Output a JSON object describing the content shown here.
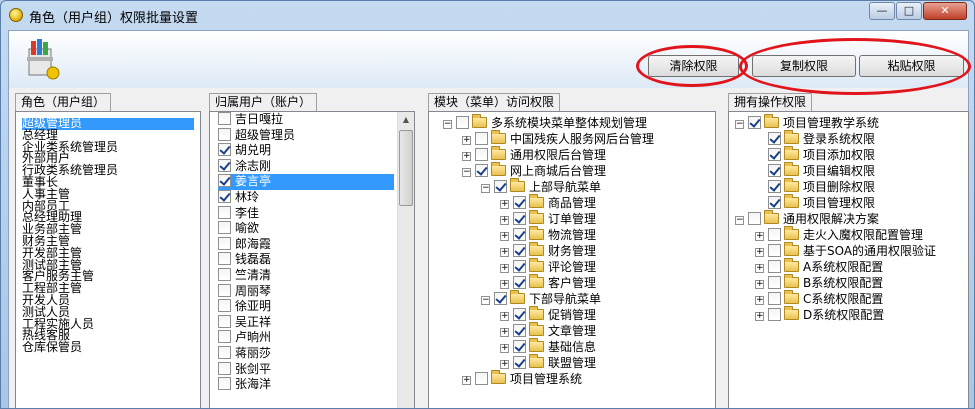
{
  "window": {
    "title": "角色（用户组）权限批量设置",
    "min_label": "—",
    "max_label": "□",
    "close_label": "✕"
  },
  "toolbar": {
    "clear_label": "清除权限",
    "copy_label": "复制权限",
    "paste_label": "粘贴权限"
  },
  "roles": {
    "header": "角色（用户组）",
    "items": [
      "超级管理员",
      "总经理",
      "企业类系统管理员",
      "外部用户",
      "行政类系统管理员",
      "董事长",
      "人事主管",
      "内部员工",
      "总经理助理",
      "业务部主管",
      "财务主管",
      "开发部主管",
      "测试部主管",
      "客户服务主管",
      "工程部主管",
      "开发人员",
      "测试人员",
      "工程实施人员",
      "热线客服",
      "仓库保管员"
    ],
    "selected_index": 0
  },
  "users": {
    "header": "归属用户（账户）",
    "items": [
      {
        "name": "吉日嘎拉",
        "checked": false
      },
      {
        "name": "超级管理员",
        "checked": false
      },
      {
        "name": "胡兑明",
        "checked": true
      },
      {
        "name": "涂志刚",
        "checked": true
      },
      {
        "name": "姜言亭",
        "checked": true
      },
      {
        "name": "林玲",
        "checked": true
      },
      {
        "name": "李佳",
        "checked": false
      },
      {
        "name": "喻欲",
        "checked": false
      },
      {
        "name": "郎海霞",
        "checked": false
      },
      {
        "name": "钱磊磊",
        "checked": false
      },
      {
        "name": "竺清清",
        "checked": false
      },
      {
        "name": "周丽琴",
        "checked": false
      },
      {
        "name": "徐亚明",
        "checked": false
      },
      {
        "name": "吴正祥",
        "checked": false
      },
      {
        "name": "卢晌州",
        "checked": false
      },
      {
        "name": "蒋丽莎",
        "checked": false
      },
      {
        "name": "张剑平",
        "checked": false
      },
      {
        "name": "张海洋",
        "checked": false
      }
    ],
    "selected_index": 4
  },
  "modules": {
    "header": "模块（菜单）访问权限",
    "nodes": [
      {
        "label": "多系统模块菜单整体规划管理",
        "level": 0,
        "exp": "-",
        "checked": false
      },
      {
        "label": "中国残疾人服务网后台管理",
        "level": 1,
        "exp": "+",
        "checked": false
      },
      {
        "label": "通用权限后台管理",
        "level": 1,
        "exp": "+",
        "checked": false
      },
      {
        "label": "网上商城后台管理",
        "level": 1,
        "exp": "-",
        "checked": true
      },
      {
        "label": "上部导航菜单",
        "level": 2,
        "exp": "-",
        "checked": true
      },
      {
        "label": "商品管理",
        "level": 3,
        "exp": "+",
        "checked": true
      },
      {
        "label": "订单管理",
        "level": 3,
        "exp": "+",
        "checked": true
      },
      {
        "label": "物流管理",
        "level": 3,
        "exp": "+",
        "checked": true
      },
      {
        "label": "财务管理",
        "level": 3,
        "exp": "+",
        "checked": true
      },
      {
        "label": "评论管理",
        "level": 3,
        "exp": "+",
        "checked": true
      },
      {
        "label": "客户管理",
        "level": 3,
        "exp": "+",
        "checked": true
      },
      {
        "label": "下部导航菜单",
        "level": 2,
        "exp": "-",
        "checked": true
      },
      {
        "label": "促销管理",
        "level": 3,
        "exp": "+",
        "checked": true
      },
      {
        "label": "文章管理",
        "level": 3,
        "exp": "+",
        "checked": true
      },
      {
        "label": "基础信息",
        "level": 3,
        "exp": "+",
        "checked": true
      },
      {
        "label": "联盟管理",
        "level": 3,
        "exp": "+",
        "checked": true
      },
      {
        "label": "项目管理系统",
        "level": 1,
        "exp": "+",
        "checked": false
      }
    ]
  },
  "operations": {
    "header": "拥有操作权限",
    "nodes": [
      {
        "label": "项目管理教学系统",
        "level": 0,
        "exp": "-",
        "checked": true
      },
      {
        "label": "登录系统权限",
        "level": 1,
        "exp": "",
        "checked": true
      },
      {
        "label": "项目添加权限",
        "level": 1,
        "exp": "",
        "checked": true
      },
      {
        "label": "项目编辑权限",
        "level": 1,
        "exp": "",
        "checked": true
      },
      {
        "label": "项目删除权限",
        "level": 1,
        "exp": "",
        "checked": true
      },
      {
        "label": "项目管理权限",
        "level": 1,
        "exp": "",
        "checked": true
      },
      {
        "label": "通用权限解决方案",
        "level": 0,
        "exp": "-",
        "checked": false
      },
      {
        "label": "走火入魔权限配置管理",
        "level": 1,
        "exp": "+",
        "checked": false
      },
      {
        "label": "基于SOA的通用权限验证",
        "level": 1,
        "exp": "+",
        "checked": false
      },
      {
        "label": "A系统权限配置",
        "level": 1,
        "exp": "+",
        "checked": false
      },
      {
        "label": "B系统权限配置",
        "level": 1,
        "exp": "+",
        "checked": false
      },
      {
        "label": "C系统权限配置",
        "level": 1,
        "exp": "+",
        "checked": false
      },
      {
        "label": "D系统权限配置",
        "level": 1,
        "exp": "+",
        "checked": false
      }
    ]
  },
  "colors": {
    "selection": "#3399ff",
    "highlight_ring": "#e0141a",
    "window_frame": "#a9c6e6"
  },
  "icons": {
    "app": "app-icon",
    "logo": "toolbox-logo-icon",
    "folder": "folder-icon"
  }
}
